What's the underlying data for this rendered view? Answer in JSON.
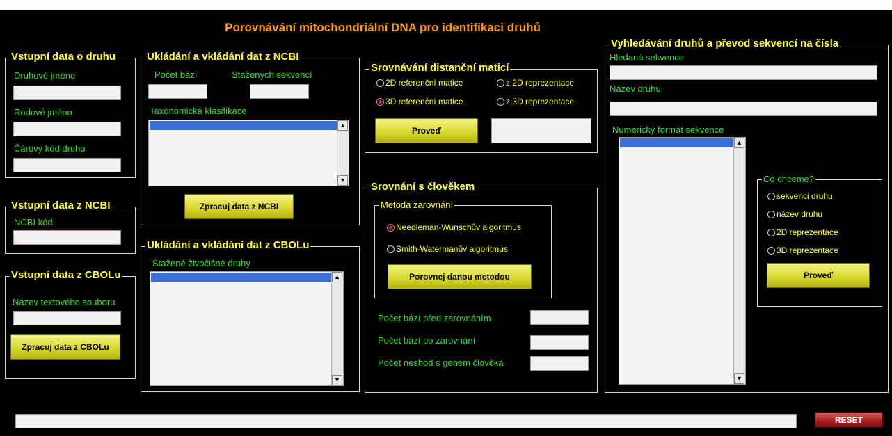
{
  "app": {
    "title": "Porovnávání mitochondriální DNA pro identifikaci druhů"
  },
  "species_input": {
    "title": "Vstupní data o druhu",
    "genus_species_label": "Druhové jméno",
    "genus_label": "Rodové jméno",
    "barcode_label": "Čárový kód druhu"
  },
  "ncbi_input": {
    "title": "Vstupní data z NCBI",
    "code_label": "NCBI kód"
  },
  "cbol_input": {
    "title": "Vstupní data z CBOLu",
    "file_label": "Název textového souboru",
    "button": "Zpracuj data z CBOLu"
  },
  "ncbi_store": {
    "title": "Ukládání a vkládání dat z NCBI",
    "bases_label": "Počet bází",
    "downloaded_label": "Stažených sekvencí",
    "taxonomy_label": "Taxonomická klasifikace",
    "button": "Zpracuj data z NCBI"
  },
  "cbol_store": {
    "title": "Ukládání a vkládání dat z CBOLu",
    "species_label": "Stažené živočišné druhy"
  },
  "distance": {
    "title": "Srovnávání distanční maticí",
    "options": [
      "2D referenční matice",
      "3D referenční matice",
      "z 2D reprezentace",
      "z 3D reprezentace"
    ],
    "selected": "3D referenční matice",
    "button": "Proveď"
  },
  "human": {
    "title": "Srovnání s člověkem",
    "method_title": "Metoda zarovnání",
    "methods": [
      "Needleman-Wunschův algoritmus",
      "Smith-Watermanův algoritmus"
    ],
    "selected": "Needleman-Wunschův algoritmus",
    "button": "Porovnej danou metodou",
    "before_label": "Počet bází před zarovnáním",
    "after_label": "Počet bází po zarovnání",
    "mismatch_label": "Počet neshod s genem člověka"
  },
  "search": {
    "title": "Vyhledávání druhů a převod sekvencí na čísla",
    "sequence_label": "Hledaná sekvence",
    "species_label": "Název druhu",
    "numeric_label": "Numerický formát sekvence",
    "want_title": "Co chceme?",
    "options": [
      "sekvenci druhu",
      "název druhu",
      "2D reprezentace",
      "3D reprezentace"
    ],
    "button": "Proveď"
  },
  "footer": {
    "reset": "RESET"
  }
}
